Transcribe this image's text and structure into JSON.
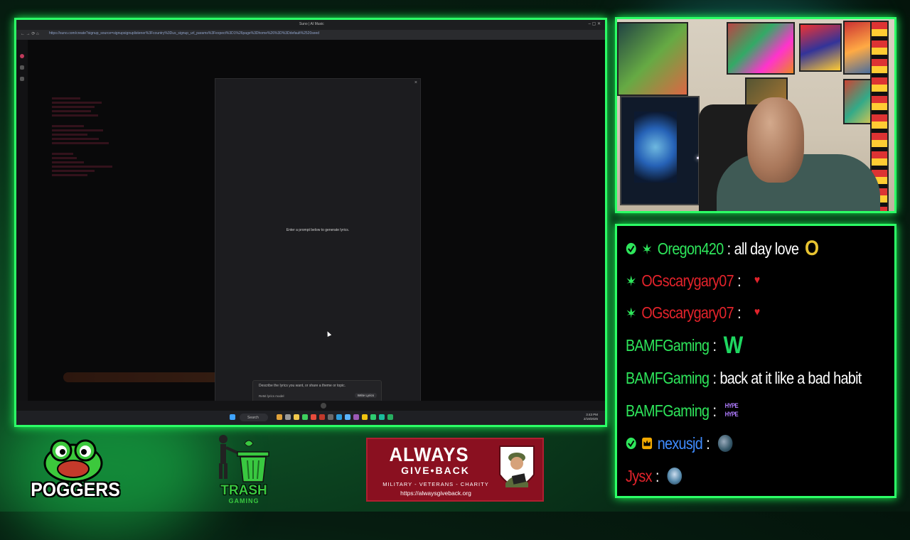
{
  "browser": {
    "tab_title": "Suno | AI Music",
    "url": "https://suno.com/create?signup_source=signupsignuplistener%3Fcountry%3Dus_signup_url_params%3Fexpect%3D1%26page%3Dhome%26%3D%3Ddefault%2520seed"
  },
  "lyrics_modal": {
    "close_icon": "×",
    "empty_message": "Enter a prompt below to generate lyrics.",
    "prompt_placeholder": "Describe the lyrics you want, or share a theme or topic.",
    "model_select": "ReMi lyrics model",
    "write_button": "Write Lyrics"
  },
  "taskbar": {
    "search_label": "Search",
    "time": "3:43 PM",
    "date": "2/19/2025"
  },
  "chat": {
    "messages": [
      {
        "user": "Oregon420",
        "color": "#2ee65b",
        "text": "all day love",
        "emote": "O"
      },
      {
        "user": "OGscarygary07",
        "color": "#e3232b",
        "text": "",
        "emote": "♥"
      },
      {
        "user": "OGscarygary07",
        "color": "#e3232b",
        "text": "",
        "emote": "♥"
      },
      {
        "user": "BAMFGaming",
        "color": "#2ee65b",
        "text": "",
        "emote": "W"
      },
      {
        "user": "BAMFGaming",
        "color": "#2ee65b",
        "text": "back at it like a bad habit",
        "emote": ""
      },
      {
        "user": "BAMFGaming",
        "color": "#2ee65b",
        "text": "",
        "emote": "HYPE HYPE"
      },
      {
        "user": "nexusjd",
        "color": "#3f8cff",
        "text": "",
        "emote": ""
      },
      {
        "user": "Jysx",
        "color": "#e3232b",
        "text": "",
        "emote": ""
      }
    ]
  },
  "logos": {
    "poggers": "POGGERS",
    "trash": "TRASH",
    "trash_sub": "GAMING",
    "agb_title": "ALWAYS",
    "agb_sub": "GIVE•BACK",
    "agb_tag": "MILITARY - VETERANS - CHARITY",
    "agb_url": "https://alwaysgiveback.org"
  },
  "colors": {
    "frame": "#2cff66",
    "accent_green": "#2ee65b",
    "accent_red": "#e3232b"
  }
}
